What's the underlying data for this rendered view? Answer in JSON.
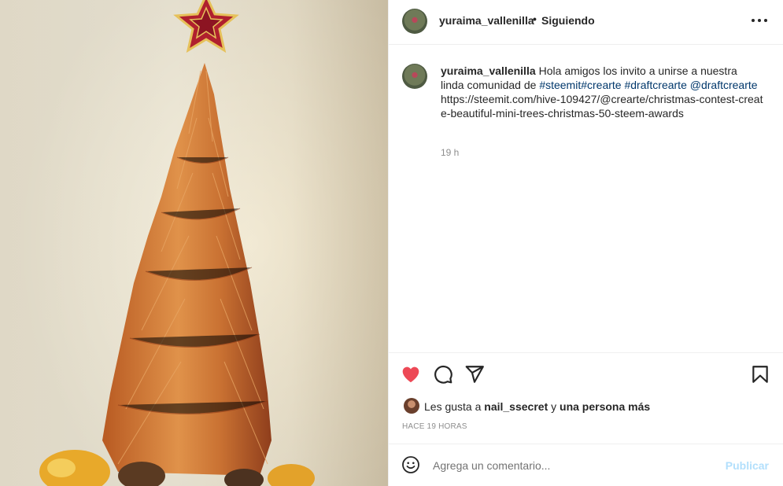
{
  "post": {
    "username": "yuraima_vallenilla",
    "separator": "•",
    "follow_status": "Siguiendo",
    "caption": {
      "username": "yuraima_vallenilla",
      "text_1": "Hola amigos los invito a unirse a nuestra linda comunidad de ",
      "hashtag_1": "#steemit",
      "hashtag_2": "#crearte",
      "hashtag_3": "#draftcrearte",
      "mention": "@draftcrearte",
      "url": "https://steemit.com/hive-109427/@crearte/christmas-contest-create-beautiful-mini-trees-christmas-50-steem-awards"
    },
    "time_ago": "19 h",
    "likes": {
      "prefix": "Les gusta a",
      "user": "nail_ssecret",
      "middle": "y",
      "suffix": "una persona más"
    },
    "posted_label": "HACE 19 HORAS",
    "comment_placeholder": "Agrega un comentario...",
    "publish_label": "Publicar"
  },
  "icons": {
    "more": "more-horizontal-icon",
    "like": "heart-icon",
    "comment": "comment-icon",
    "share": "share-icon",
    "save": "bookmark-icon",
    "emoji": "emoji-icon"
  },
  "colors": {
    "like_active": "#ed4956",
    "link": "#00376b",
    "muted": "#8e8e8e",
    "publish_disabled": "#b2dffc"
  }
}
